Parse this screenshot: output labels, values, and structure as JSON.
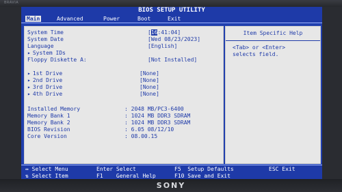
{
  "title": "BIOS SETUP UTILITY",
  "bezel": {
    "top_brand": "BRAVIA",
    "bottom_brand": "SONY"
  },
  "menu": [
    {
      "label": "Main"
    },
    {
      "label": "Advanced"
    },
    {
      "label": "Power"
    },
    {
      "label": "Boot"
    },
    {
      "label": "Exit"
    }
  ],
  "main": {
    "system_time": {
      "label": "System Time",
      "value_prefix": "[",
      "value_highlight": "16",
      "value_suffix": ":41:04]"
    },
    "system_date": {
      "label": "System Date",
      "value": "[Wed 08/23/2023]"
    },
    "language": {
      "label": "Language",
      "value": "[English]"
    },
    "system_ids": {
      "label": "System IDs"
    },
    "floppy": {
      "label": "Floppy Diskette A:",
      "value": "[Not Installed]"
    },
    "drives": [
      {
        "label": "1st Drive",
        "value": "[None]"
      },
      {
        "label": "2nd Drive",
        "value": "[None]"
      },
      {
        "label": "3rd Drive",
        "value": "[None]"
      },
      {
        "label": "4th Drive",
        "value": "[None]"
      }
    ],
    "info": [
      {
        "label": "Installed Memory",
        "value": ": 2048 MB/PC3-6400"
      },
      {
        "label": "Memory Bank 1",
        "value": ": 1024 MB DDR3 SDRAM"
      },
      {
        "label": "Memory Bank 2",
        "value": ": 1024 MB DDR3 SDRAM"
      },
      {
        "label": "BIOS Revision",
        "value": ": 6.05 08/12/10"
      },
      {
        "label": "Core Version",
        "value": ": 08.00.15"
      }
    ]
  },
  "help": {
    "title": "Item Specific Help",
    "lines": [
      "<Tab> or <Enter>",
      "selects field."
    ]
  },
  "status": [
    {
      "key": "↔",
      "text": "Select Menu"
    },
    {
      "key": "⇅",
      "text": "Select Item"
    },
    {
      "key": "Enter",
      "text": "Select"
    },
    {
      "key": "F1",
      "text": "General Help"
    },
    {
      "key": "F5",
      "text": "Setup Defaults"
    },
    {
      "key": "F10",
      "text": "Save and Exit"
    },
    {
      "key": "ESC",
      "text": "Exit"
    }
  ]
}
